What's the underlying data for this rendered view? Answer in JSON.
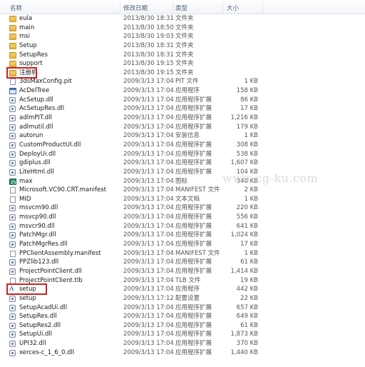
{
  "columns": {
    "name": "名称",
    "date": "修改日期",
    "type": "类型",
    "size": "大小"
  },
  "watermark": "www.cg-ku.com",
  "files": [
    {
      "name": "eula",
      "date": "2013/8/30 18:31",
      "type": "文件夹",
      "size": "",
      "icon": "folder-icon"
    },
    {
      "name": "main",
      "date": "2013/8/30 18:50",
      "type": "文件夹",
      "size": "",
      "icon": "folder-icon"
    },
    {
      "name": "msi",
      "date": "2013/8/30 19:03",
      "type": "文件夹",
      "size": "",
      "icon": "folder-icon"
    },
    {
      "name": "Setup",
      "date": "2013/8/30 18:31",
      "type": "文件夹",
      "size": "",
      "icon": "folder-icon"
    },
    {
      "name": "SetupRes",
      "date": "2013/8/30 18:31",
      "type": "文件夹",
      "size": "",
      "icon": "folder-icon"
    },
    {
      "name": "support",
      "date": "2013/8/30 19:15",
      "type": "文件夹",
      "size": "",
      "icon": "folder-icon"
    },
    {
      "name": "注册机",
      "date": "2013/8/30 19:15",
      "type": "文件夹",
      "size": "",
      "icon": "folder-icon",
      "highlight": true
    },
    {
      "name": "3dsMaxConfig.pit",
      "date": "2009/3/13 17:04",
      "type": "PIT 文件",
      "size": "1 KB",
      "icon": "file-icon"
    },
    {
      "name": "AcDelTree",
      "date": "2009/3/13 17:04",
      "type": "应用程序",
      "size": "158 KB",
      "icon": "exe-icon"
    },
    {
      "name": "AcSetup.dll",
      "date": "2009/3/13 17:04",
      "type": "应用程序扩展",
      "size": "86 KB",
      "icon": "dll-icon"
    },
    {
      "name": "AcSetupRes.dll",
      "date": "2009/3/13 17:04",
      "type": "应用程序扩展",
      "size": "17 KB",
      "icon": "dll-icon"
    },
    {
      "name": "adlmPIT.dll",
      "date": "2009/3/13 17:04",
      "type": "应用程序扩展",
      "size": "1,216 KB",
      "icon": "dll-icon"
    },
    {
      "name": "adlmutil.dll",
      "date": "2009/3/13 17:04",
      "type": "应用程序扩展",
      "size": "179 KB",
      "icon": "dll-icon"
    },
    {
      "name": "autorun",
      "date": "2009/3/13 17:04",
      "type": "安装信息",
      "size": "1 KB",
      "icon": "settings-file-icon"
    },
    {
      "name": "CustomProductUI.dll",
      "date": "2009/3/13 17:04",
      "type": "应用程序扩展",
      "size": "308 KB",
      "icon": "dll-icon"
    },
    {
      "name": "DeployUi.dll",
      "date": "2009/3/13 17:04",
      "type": "应用程序扩展",
      "size": "538 KB",
      "icon": "dll-icon"
    },
    {
      "name": "gdiplus.dll",
      "date": "2009/3/13 17:04",
      "type": "应用程序扩展",
      "size": "1,607 KB",
      "icon": "dll-icon"
    },
    {
      "name": "LiteHtml.dll",
      "date": "2009/3/13 17:04",
      "type": "应用程序扩展",
      "size": "104 KB",
      "icon": "dll-icon"
    },
    {
      "name": "max",
      "date": "2009/3/13 17:04",
      "type": "图标",
      "size": "340 KB",
      "icon": "max-icon"
    },
    {
      "name": "Microsoft.VC90.CRT.manifest",
      "date": "2009/3/13 17:04",
      "type": "MANIFEST 文件",
      "size": "2 KB",
      "icon": "file-icon"
    },
    {
      "name": "MID",
      "date": "2009/3/13 17:04",
      "type": "文本文档",
      "size": "1 KB",
      "icon": "file-icon"
    },
    {
      "name": "msvcm90.dll",
      "date": "2009/3/13 17:04",
      "type": "应用程序扩展",
      "size": "220 KB",
      "icon": "dll-icon"
    },
    {
      "name": "msvcp90.dll",
      "date": "2009/3/13 17:04",
      "type": "应用程序扩展",
      "size": "556 KB",
      "icon": "dll-icon"
    },
    {
      "name": "msvcr90.dll",
      "date": "2009/3/13 17:04",
      "type": "应用程序扩展",
      "size": "641 KB",
      "icon": "dll-icon"
    },
    {
      "name": "PatchMgr.dll",
      "date": "2009/3/13 17:04",
      "type": "应用程序扩展",
      "size": "1,024 KB",
      "icon": "dll-icon"
    },
    {
      "name": "PatchMgrRes.dll",
      "date": "2009/3/13 17:04",
      "type": "应用程序扩展",
      "size": "17 KB",
      "icon": "dll-icon"
    },
    {
      "name": "PPClientAssembly.manifest",
      "date": "2009/3/13 17:04",
      "type": "MANIFEST 文件",
      "size": "1 KB",
      "icon": "file-icon"
    },
    {
      "name": "PPZlib123.dll",
      "date": "2009/3/13 17:04",
      "type": "应用程序扩展",
      "size": "61 KB",
      "icon": "dll-icon"
    },
    {
      "name": "ProjectPointClient.dll",
      "date": "2009/3/13 17:04",
      "type": "应用程序扩展",
      "size": "1,414 KB",
      "icon": "dll-icon"
    },
    {
      "name": "ProjectPointClient.tlb",
      "date": "2009/3/13 17:04",
      "type": "TLB 文件",
      "size": "19 KB",
      "icon": "file-icon"
    },
    {
      "name": "setup",
      "date": "2009/3/13 17:04",
      "type": "应用程序",
      "size": "442 KB",
      "icon": "setup-icon",
      "highlight": true
    },
    {
      "name": "setup",
      "date": "2009/3/13 17:12",
      "type": "配置设置",
      "size": "22 KB",
      "icon": "settings-file-icon"
    },
    {
      "name": "SetupAcadUi.dll",
      "date": "2009/3/13 17:04",
      "type": "应用程序扩展",
      "size": "657 KB",
      "icon": "dll-icon"
    },
    {
      "name": "SetupRes.dll",
      "date": "2009/3/13 17:04",
      "type": "应用程序扩展",
      "size": "649 KB",
      "icon": "dll-icon"
    },
    {
      "name": "SetupRes2.dll",
      "date": "2009/3/13 17:04",
      "type": "应用程序扩展",
      "size": "61 KB",
      "icon": "dll-icon"
    },
    {
      "name": "SetupUi.dll",
      "date": "2009/3/13 17:04",
      "type": "应用程序扩展",
      "size": "1,873 KB",
      "icon": "dll-icon"
    },
    {
      "name": "UPI32.dll",
      "date": "2009/3/13 17:04",
      "type": "应用程序扩展",
      "size": "370 KB",
      "icon": "dll-icon"
    },
    {
      "name": "xerces-c_1_6_0.dll",
      "date": "2009/3/13 17:04",
      "type": "应用程序扩展",
      "size": "1,440 KB",
      "icon": "dll-icon"
    }
  ]
}
